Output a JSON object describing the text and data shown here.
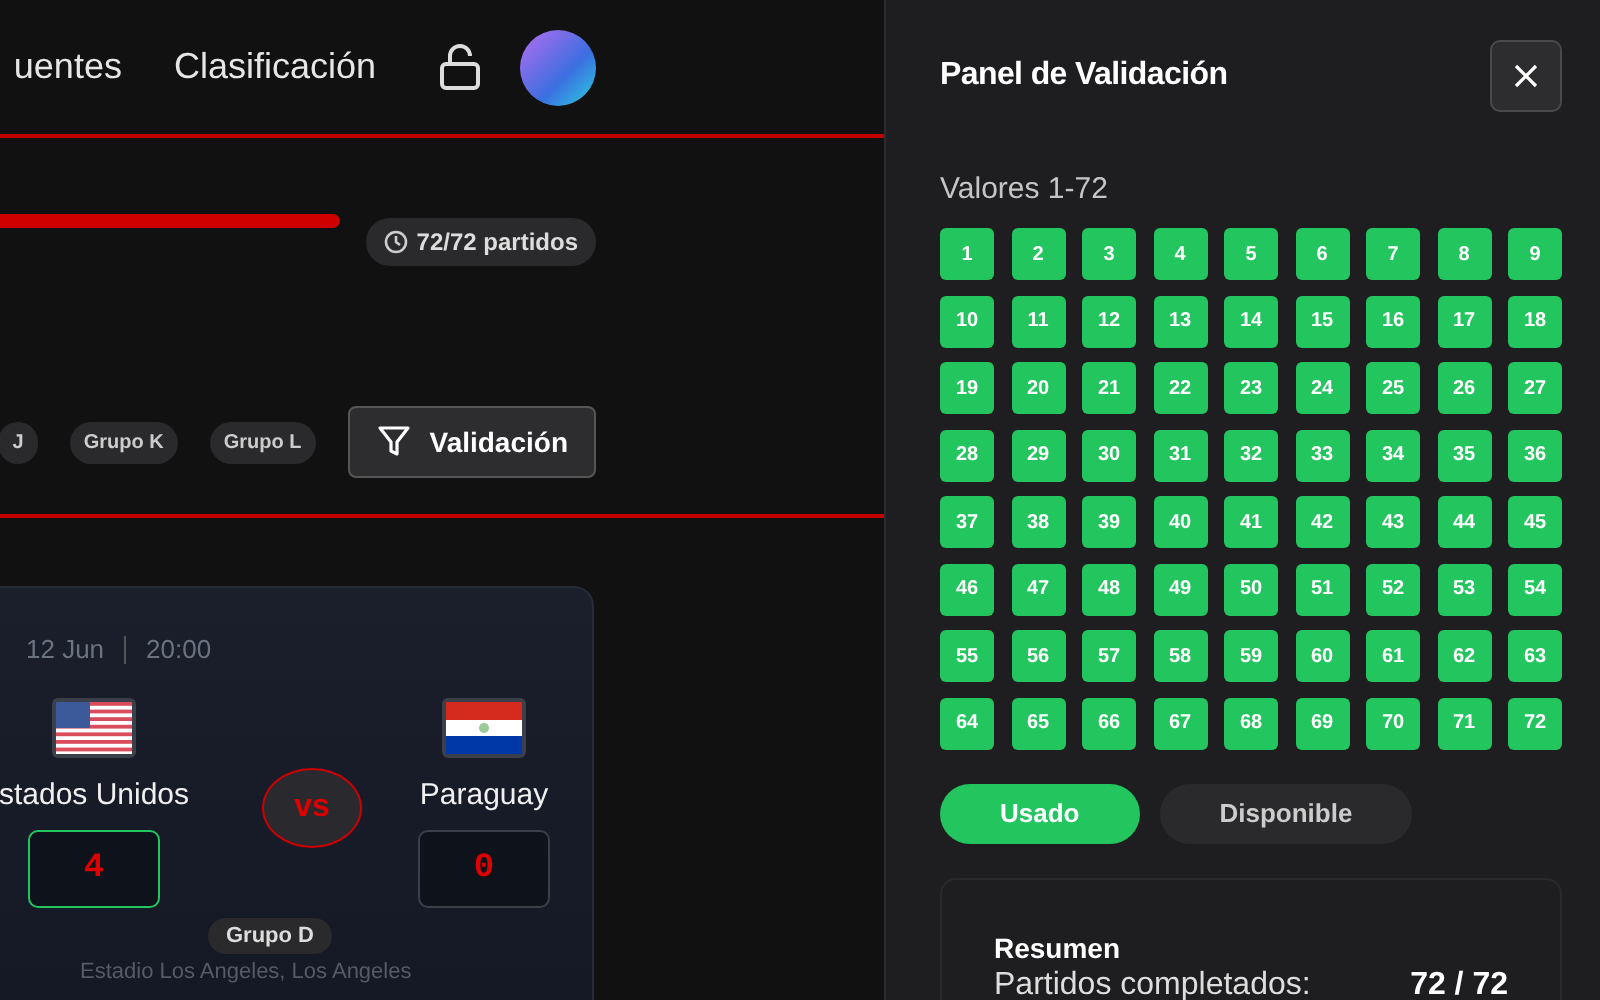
{
  "nav": {
    "items": [
      "uentes",
      "Clasificación"
    ]
  },
  "progress": {
    "level": 1,
    "badge": "72/72 partidos"
  },
  "filters": {
    "chips": [
      "J",
      "Grupo K",
      "Grupo L"
    ],
    "button": "Validación"
  },
  "match": {
    "date": "12 Jun",
    "time": "20:00",
    "vs": "vs",
    "group": "Grupo D",
    "venue": "Estadio Los Angeles, Los Angeles",
    "teams": [
      {
        "name": "stados Unidos",
        "kind": "usa",
        "score": "4",
        "winner": true
      },
      {
        "name": "Paraguay",
        "kind": "paraguay",
        "score": "0",
        "winner": false
      }
    ]
  },
  "panel": {
    "title": "Panel de Validación",
    "subtitle": "Valores 1-72",
    "cells": [
      {
        "n": "1",
        "used": true
      },
      {
        "n": "2",
        "used": true
      },
      {
        "n": "3",
        "used": true
      },
      {
        "n": "4",
        "used": true
      },
      {
        "n": "5",
        "used": true
      },
      {
        "n": "6",
        "used": true
      },
      {
        "n": "7",
        "used": true
      },
      {
        "n": "8",
        "used": true
      },
      {
        "n": "9",
        "used": true
      },
      {
        "n": "10",
        "used": true
      },
      {
        "n": "11",
        "used": true
      },
      {
        "n": "12",
        "used": true
      },
      {
        "n": "13",
        "used": true
      },
      {
        "n": "14",
        "used": true
      },
      {
        "n": "15",
        "used": true
      },
      {
        "n": "16",
        "used": true
      },
      {
        "n": "17",
        "used": true
      },
      {
        "n": "18",
        "used": true
      },
      {
        "n": "19",
        "used": true
      },
      {
        "n": "20",
        "used": true
      },
      {
        "n": "21",
        "used": true
      },
      {
        "n": "22",
        "used": true
      },
      {
        "n": "23",
        "used": true
      },
      {
        "n": "24",
        "used": true
      },
      {
        "n": "25",
        "used": true
      },
      {
        "n": "26",
        "used": true
      },
      {
        "n": "27",
        "used": true
      },
      {
        "n": "28",
        "used": true
      },
      {
        "n": "29",
        "used": true
      },
      {
        "n": "30",
        "used": true
      },
      {
        "n": "31",
        "used": true
      },
      {
        "n": "32",
        "used": true
      },
      {
        "n": "33",
        "used": true
      },
      {
        "n": "34",
        "used": true
      },
      {
        "n": "35",
        "used": true
      },
      {
        "n": "36",
        "used": true
      },
      {
        "n": "37",
        "used": true
      },
      {
        "n": "38",
        "used": true
      },
      {
        "n": "39",
        "used": true
      },
      {
        "n": "40",
        "used": true
      },
      {
        "n": "41",
        "used": true
      },
      {
        "n": "42",
        "used": true
      },
      {
        "n": "43",
        "used": true
      },
      {
        "n": "44",
        "used": true
      },
      {
        "n": "45",
        "used": true
      },
      {
        "n": "46",
        "used": true
      },
      {
        "n": "47",
        "used": true
      },
      {
        "n": "48",
        "used": true
      },
      {
        "n": "49",
        "used": true
      },
      {
        "n": "50",
        "used": true
      },
      {
        "n": "51",
        "used": true
      },
      {
        "n": "52",
        "used": true
      },
      {
        "n": "53",
        "used": true
      },
      {
        "n": "54",
        "used": true
      },
      {
        "n": "55",
        "used": true
      },
      {
        "n": "56",
        "used": true
      },
      {
        "n": "57",
        "used": true
      },
      {
        "n": "58",
        "used": true
      },
      {
        "n": "59",
        "used": true
      },
      {
        "n": "60",
        "used": true
      },
      {
        "n": "61",
        "used": true
      },
      {
        "n": "62",
        "used": true
      },
      {
        "n": "63",
        "used": true
      },
      {
        "n": "64",
        "used": true
      },
      {
        "n": "65",
        "used": true
      },
      {
        "n": "66",
        "used": true
      },
      {
        "n": "67",
        "used": true
      },
      {
        "n": "68",
        "used": true
      },
      {
        "n": "69",
        "used": true
      },
      {
        "n": "70",
        "used": true
      },
      {
        "n": "71",
        "used": true
      },
      {
        "n": "72",
        "used": true
      }
    ],
    "legend": [
      {
        "label": "Usado",
        "color": "#22c55e"
      },
      {
        "label": "Disponible",
        "color": "#2a2a2d"
      }
    ],
    "summary": {
      "title": "Resumen",
      "label": "Partidos completados:",
      "value": "72 / 72"
    }
  }
}
